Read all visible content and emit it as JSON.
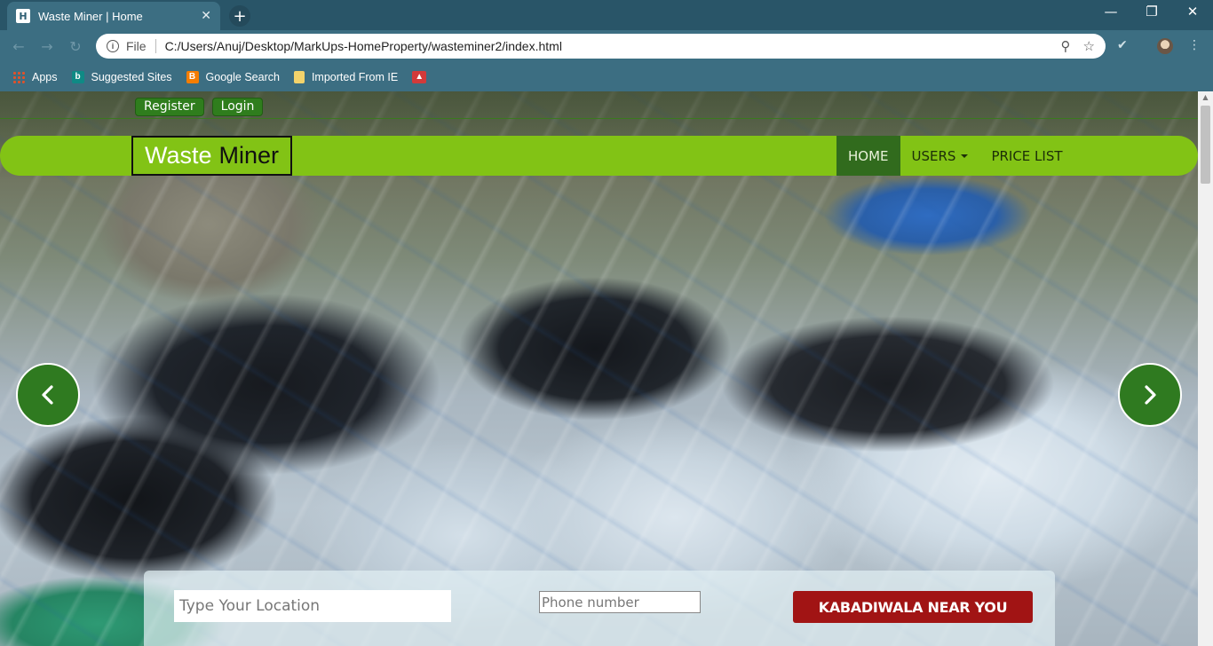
{
  "browser": {
    "tab": {
      "title": "Waste Miner | Home",
      "favicon_letter": "H",
      "close_glyph": "✕"
    },
    "new_tab_glyph": "+",
    "window_controls": {
      "minimize": "—",
      "restore": "❐",
      "close": "✕"
    },
    "omnibox": {
      "scheme": "File",
      "url": "C:/Users/Anuj/Desktop/MarkUps-HomeProperty/wasteminer2/index.html"
    },
    "bookmarks": [
      {
        "label": "Apps",
        "icon": "apps-grid-icon",
        "color": "#e0522a"
      },
      {
        "label": "Suggested Sites",
        "icon": "bing-icon",
        "color": "#0f8a85"
      },
      {
        "label": "Google Search",
        "icon": "blogger-icon",
        "color": "#f57d00"
      },
      {
        "label": "Imported From IE",
        "icon": "folder-icon",
        "color": "#f3d36b"
      },
      {
        "label": "",
        "icon": "image-icon",
        "color": "#d23a3a"
      }
    ]
  },
  "page": {
    "top_links": {
      "register": "Register",
      "login": "Login"
    },
    "brand": {
      "part1": "Waste",
      "part2": "Miner"
    },
    "nav": {
      "home": "HOME",
      "users": "USERS",
      "price_list": "PRICE LIST"
    },
    "carousel": {
      "prev": "previous-slide",
      "next": "next-slide"
    },
    "search": {
      "location_placeholder": "Type Your Location",
      "phone_placeholder": "Phone number",
      "button": "KABADIWALA NEAR YOU"
    }
  },
  "colors": {
    "navbar": "#82c315",
    "nav_active": "#316b1d",
    "top_link": "#2f7d1d",
    "carousel_button": "#2f7a20",
    "cta": "#a11414",
    "chrome": "#3c6e82"
  }
}
